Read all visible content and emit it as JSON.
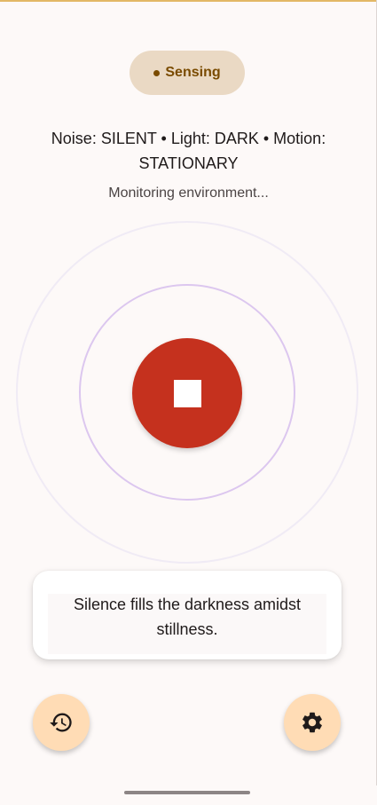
{
  "status": {
    "label": "Sensing",
    "dot_color": "#7a4b00",
    "pill_color": "#ead9c4"
  },
  "environment": {
    "readout": "Noise: SILENT • Light: DARK • Motion: STATIONARY",
    "monitoring_text": "Monitoring environment..."
  },
  "record_control": {
    "state_icon": "stop-icon",
    "color": "#c5311e"
  },
  "caption": {
    "text": "Silence fills the darkness amidst stillness."
  },
  "actions": {
    "history_icon": "history-icon",
    "settings_icon": "gear-icon",
    "fab_color": "#ffdcb5"
  }
}
